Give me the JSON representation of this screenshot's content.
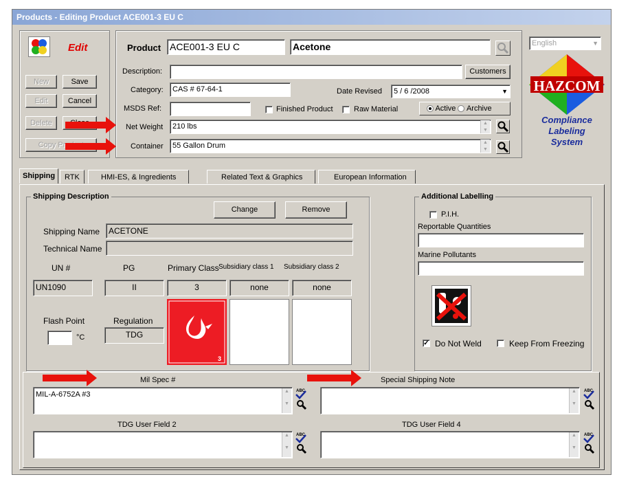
{
  "window": {
    "title": "Products - Editing Product ACE001-3 EU C"
  },
  "mode": {
    "label": "Edit"
  },
  "toolbar": {
    "new": "New",
    "save": "Save",
    "edit": "Edit",
    "cancel": "Cancel",
    "delete": "Delete",
    "close": "Close",
    "copy": "Copy Product"
  },
  "product": {
    "label": "Product",
    "code": "ACE001-3 EU C",
    "name": "Acetone",
    "description_label": "Description:",
    "description": "",
    "customers_btn": "Customers",
    "category_label": "Category:",
    "category": "CAS # 67-64-1",
    "date_revised_label": "Date Revised",
    "date_revised": "5 / 6 /2008",
    "msds_label": "MSDS Ref:",
    "msds": "",
    "finished_label": "Finished Product",
    "raw_label": "Raw Material",
    "active_label": "Active",
    "archive_label": "Archive",
    "net_weight_label": "Net Weight",
    "net_weight": "210 lbs",
    "container_label": "Container",
    "container": "55 Gallon Drum"
  },
  "language": {
    "selected": "English"
  },
  "logo": {
    "brand": "HAZCOM",
    "line1": "Compliance",
    "line2": "Labeling",
    "line3": "System"
  },
  "tabs": [
    "Shipping",
    "RTK",
    "HMI-ES, & Ingredients",
    "Related Text & Graphics",
    "European Information"
  ],
  "shipping": {
    "group_title": "Shipping Description",
    "change_btn": "Change",
    "remove_btn": "Remove",
    "shipping_name_label": "Shipping Name",
    "shipping_name": "ACETONE",
    "technical_name_label": "Technical Name",
    "technical_name": "",
    "un_label": "UN #",
    "pg_label": "PG",
    "primary_label": "Primary Class",
    "sub1_label": "Subsidiary class 1",
    "sub2_label": "Subsidiary class 2",
    "un": "UN1090",
    "pg": "II",
    "primary": "3",
    "sub1": "none",
    "sub2": "none",
    "flash_label": "Flash Point",
    "flash_unit": "°C",
    "flash": "",
    "regulation_label": "Regulation",
    "regulation": "TDG",
    "placard_num": "3"
  },
  "additional": {
    "title": "Additional Labelling",
    "pih": "P.I.H.",
    "rq_label": "Reportable Quantities",
    "rq": "",
    "marine_label": "Marine Pollutants",
    "marine": "",
    "do_not_weld": "Do Not Weld",
    "keep_from_freezing": "Keep From Freezing"
  },
  "fields": {
    "mil_spec_label": "Mil Spec #",
    "mil_spec": "MIL-A-6752A #3",
    "special_label": "Special Shipping Note",
    "special": "",
    "tdg2_label": "TDG User Field 2",
    "tdg2": "",
    "tdg4_label": "TDG User Field 4",
    "tdg4": "",
    "abc": "ABC"
  },
  "colors": {
    "accent_red": "#e8120c",
    "title_blue": "#8aa6d6",
    "edit_red": "#e00000",
    "logo_blue": "#1a2c9c"
  }
}
